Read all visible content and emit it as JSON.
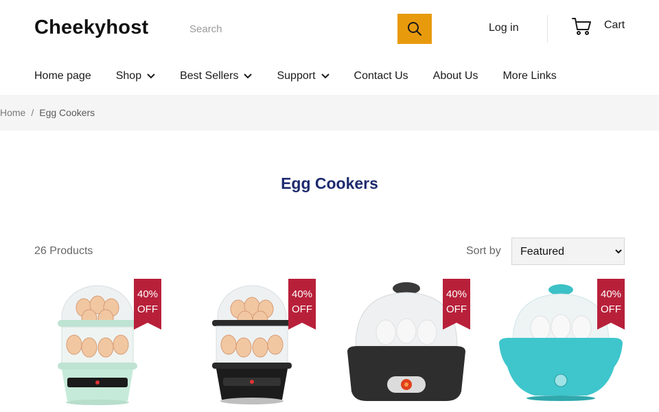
{
  "header": {
    "logo": "Cheekyhost",
    "search_placeholder": "Search",
    "login_label": "Log in",
    "cart_label": "Cart",
    "accent_color": "#e89a0d"
  },
  "nav": {
    "items": [
      {
        "label": "Home page",
        "dropdown": false
      },
      {
        "label": "Shop",
        "dropdown": true
      },
      {
        "label": "Best Sellers",
        "dropdown": true
      },
      {
        "label": "Support",
        "dropdown": true
      },
      {
        "label": "Contact Us",
        "dropdown": false
      },
      {
        "label": "About Us",
        "dropdown": false
      },
      {
        "label": "More Links",
        "dropdown": false
      }
    ]
  },
  "breadcrumb": {
    "home": "Home",
    "separator": "/",
    "current": "Egg Cookers"
  },
  "collection": {
    "title": "Egg Cookers",
    "title_color": "#1e2b6e",
    "product_count": "26 Products",
    "sort_label": "Sort by",
    "sort_selected": "Featured"
  },
  "products": [
    {
      "badge_line1": "40%",
      "badge_line2": "OFF",
      "image": "mint-double-tier-egg-cooker"
    },
    {
      "badge_line1": "40%",
      "badge_line2": "OFF",
      "image": "black-double-tier-egg-cooker"
    },
    {
      "badge_line1": "40%",
      "badge_line2": "OFF",
      "image": "dark-grey-egg-cooker"
    },
    {
      "badge_line1": "40%",
      "badge_line2": "OFF",
      "image": "turquoise-egg-cooker"
    }
  ],
  "badge_color": "#b8203a"
}
